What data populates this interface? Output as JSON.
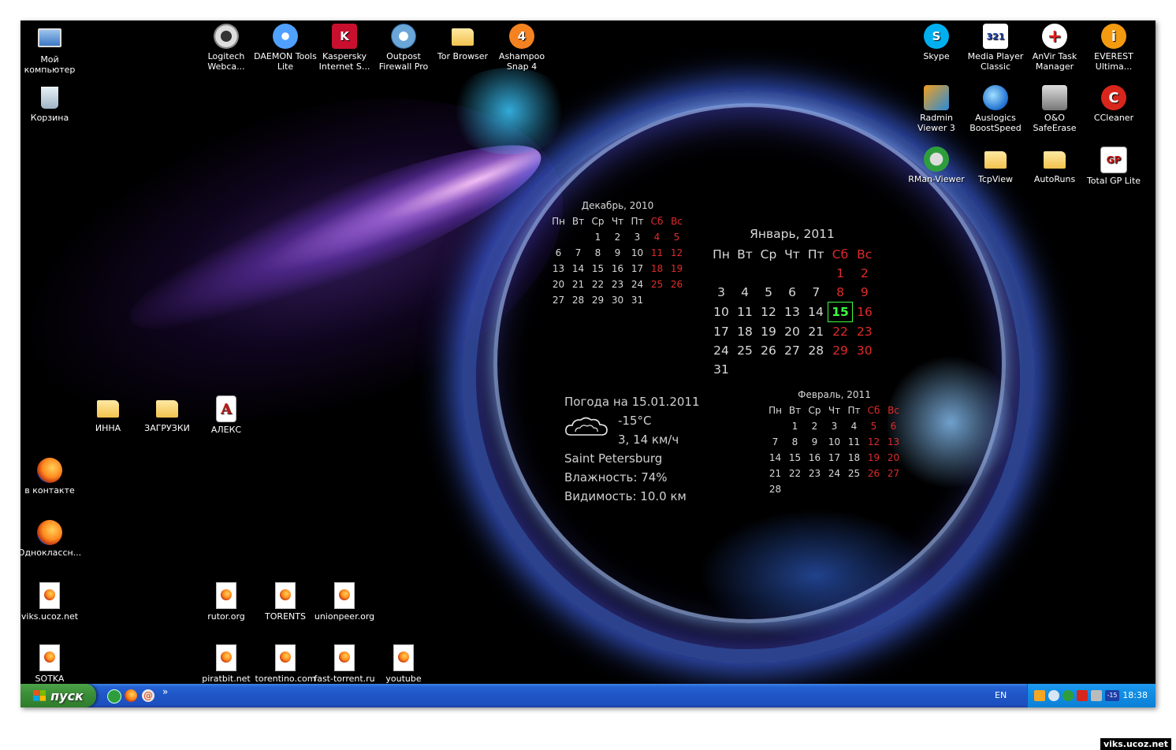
{
  "desktop_icons": {
    "my_computer": "Мой компьютер",
    "recycle_bin": "Корзина",
    "logitech": "Logitech Webca...",
    "daemon": "DAEMON Tools Lite",
    "kaspersky": "Kaspersky Internet S...",
    "outpost": "Outpost Firewall Pro",
    "tor": "Tor Browser",
    "ashampoo": "Ashampoo Snap 4",
    "skype": "Skype",
    "mpc": "Media Player Classic",
    "anvir": "AnVir Task Manager",
    "everest": "EVEREST Ultima...",
    "radmin": "Radmin Viewer 3",
    "auslogics": "Auslogics BoostSpeed",
    "oo": "O&O SafeErase",
    "ccleaner": "CCleaner",
    "rman": "RMan-Viewer",
    "tcpview": "TcpView",
    "autoruns": "AutoRuns",
    "totalgp": "Total GP Lite",
    "inna": "ИННА",
    "zagruzki": "ЗАГРУЗКИ",
    "aleks": "АЛЕКС",
    "vkontakte": "в контакте",
    "odnoklassniki": "Одноклассн...",
    "viks": "viks.ucoz.net",
    "rutor": "rutor.org",
    "torents": "TORENTS",
    "unionpeer": "unionpeer.org",
    "sotka": "SOTKA",
    "piratbit": "piratbit.net",
    "torentino": "torentino.com",
    "fasttorrent": "fast-torrent.ru",
    "youtube": "youtube"
  },
  "icon_glyphs": {
    "ashampoo": "4",
    "skype": "S",
    "mpc": "321",
    "anvir": "+",
    "everest": "i",
    "ccleaner": "C",
    "totalgp": "GP",
    "aleks": "A",
    "kaspersky": "K"
  },
  "calendars": {
    "weekdays": [
      "Пн",
      "Вт",
      "Ср",
      "Чт",
      "Пт",
      "Сб",
      "Вс"
    ],
    "december": {
      "title": "Декабрь, 2010",
      "weeks": [
        [
          "",
          "",
          "1",
          "2",
          "3",
          "4",
          "5"
        ],
        [
          "6",
          "7",
          "8",
          "9",
          "10",
          "11",
          "12"
        ],
        [
          "13",
          "14",
          "15",
          "16",
          "17",
          "18",
          "19"
        ],
        [
          "20",
          "21",
          "22",
          "23",
          "24",
          "25",
          "26"
        ],
        [
          "27",
          "28",
          "29",
          "30",
          "31",
          "",
          ""
        ]
      ]
    },
    "january": {
      "title": "Январь, 2011",
      "today": "15",
      "weeks": [
        [
          "",
          "",
          "",
          "",
          "",
          "1",
          "2"
        ],
        [
          "3",
          "4",
          "5",
          "6",
          "7",
          "8",
          "9"
        ],
        [
          "10",
          "11",
          "12",
          "13",
          "14",
          "15",
          "16"
        ],
        [
          "17",
          "18",
          "19",
          "20",
          "21",
          "22",
          "23"
        ],
        [
          "24",
          "25",
          "26",
          "27",
          "28",
          "29",
          "30"
        ],
        [
          "31",
          "",
          "",
          "",
          "",
          "",
          ""
        ]
      ]
    },
    "february": {
      "title": "Февраль, 2011",
      "weeks": [
        [
          "",
          "1",
          "2",
          "3",
          "4",
          "5",
          "6"
        ],
        [
          "7",
          "8",
          "9",
          "10",
          "11",
          "12",
          "13"
        ],
        [
          "14",
          "15",
          "16",
          "17",
          "18",
          "19",
          "20"
        ],
        [
          "21",
          "22",
          "23",
          "24",
          "25",
          "26",
          "27"
        ],
        [
          "28",
          "",
          "",
          "",
          "",
          "",
          ""
        ]
      ]
    }
  },
  "weather": {
    "title": "Погода на 15.01.2011",
    "temperature": "-15°C",
    "wind": "3, 14 км/ч",
    "city": "Saint Petersburg",
    "humidity": "Влажность: 74%",
    "visibility": "Видимость: 10.0 км",
    "icon": "cloud-icon"
  },
  "taskbar": {
    "start_label": "пуск",
    "quicklaunch_more": "»",
    "language": "EN",
    "clock": "18:38",
    "tray_temp": "-15",
    "mail_glyph": "@"
  },
  "watermark": "viks.ucoz.net",
  "colors": {
    "weekend": "#e02a2a",
    "today": "#3dff3d",
    "taskbar": "#245edb",
    "start_button": "#3c8f38"
  }
}
